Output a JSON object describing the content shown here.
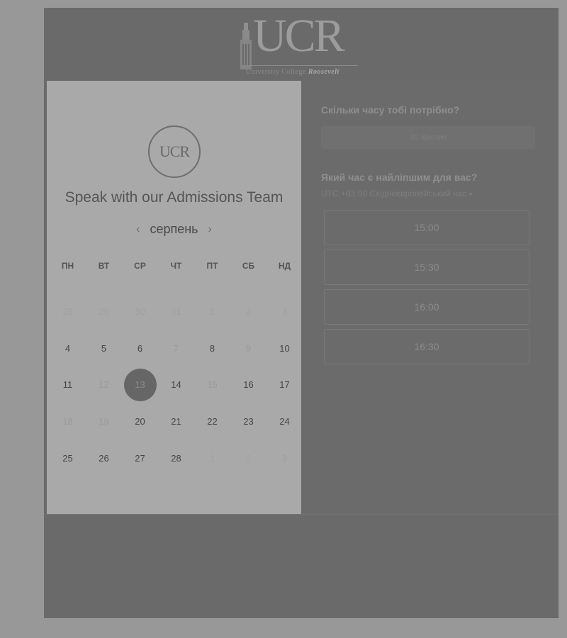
{
  "header": {
    "logo_text": "UCR",
    "logo_subtitle_plain": "University College",
    "logo_subtitle_bold": "Roosevelt"
  },
  "event": {
    "badge_text": "UCR",
    "title": "Speak with our Admissions Team"
  },
  "calendar": {
    "month": "серпень",
    "prev_label": "‹",
    "next_label": "›",
    "weekdays": [
      "ПН",
      "ВТ",
      "СР",
      "ЧТ",
      "ПТ",
      "СБ",
      "НД"
    ],
    "days": [
      {
        "label": "28",
        "state": "muted"
      },
      {
        "label": "29",
        "state": "muted"
      },
      {
        "label": "30",
        "state": "muted"
      },
      {
        "label": "31",
        "state": "muted"
      },
      {
        "label": "1",
        "state": "muted"
      },
      {
        "label": "2",
        "state": "muted"
      },
      {
        "label": "3",
        "state": "muted"
      },
      {
        "label": "4",
        "state": "available"
      },
      {
        "label": "5",
        "state": "available"
      },
      {
        "label": "6",
        "state": "available"
      },
      {
        "label": "7",
        "state": "dim"
      },
      {
        "label": "8",
        "state": "available"
      },
      {
        "label": "9",
        "state": "dim"
      },
      {
        "label": "10",
        "state": "available"
      },
      {
        "label": "11",
        "state": "available"
      },
      {
        "label": "12",
        "state": "dim"
      },
      {
        "label": "13",
        "state": "selected"
      },
      {
        "label": "14",
        "state": "available"
      },
      {
        "label": "15",
        "state": "dim"
      },
      {
        "label": "16",
        "state": "available"
      },
      {
        "label": "17",
        "state": "available"
      },
      {
        "label": "18",
        "state": "dim"
      },
      {
        "label": "19",
        "state": "dim"
      },
      {
        "label": "20",
        "state": "available"
      },
      {
        "label": "21",
        "state": "available"
      },
      {
        "label": "22",
        "state": "available"
      },
      {
        "label": "23",
        "state": "available"
      },
      {
        "label": "24",
        "state": "available"
      },
      {
        "label": "25",
        "state": "available"
      },
      {
        "label": "26",
        "state": "available"
      },
      {
        "label": "27",
        "state": "available"
      },
      {
        "label": "28",
        "state": "available"
      },
      {
        "label": "1",
        "state": "muted"
      },
      {
        "label": "2",
        "state": "muted"
      },
      {
        "label": "3",
        "state": "muted"
      }
    ]
  },
  "booking": {
    "duration_question": "Скільки часу тобі потрібно?",
    "duration_value": "30 хвилин",
    "time_question": "Який час є найліпшим для вас?",
    "timezone": "UTC +03:00 Східноєвропейський час",
    "timezone_caret": "▾",
    "slots": [
      "15:00",
      "15:30",
      "16:00",
      "16:30"
    ]
  }
}
